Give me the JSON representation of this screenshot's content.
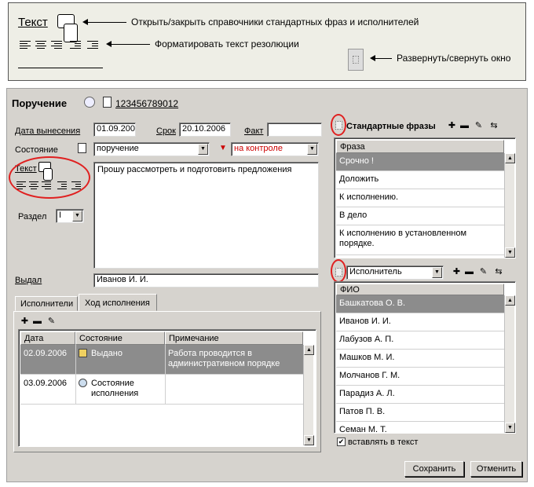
{
  "legend": {
    "text_label": "Текст",
    "toggle_refs": "Открыть/закрыть справочники стандартных фраз и исполнителей",
    "format_text": "Форматировать текст резолюции",
    "expand_window": "Развернуть/свернуть окно"
  },
  "header": {
    "title": "Поручение",
    "doc_number": "123456789012"
  },
  "fields": {
    "issue_date_label": "Дата вынесения",
    "issue_date": "01.09.2006",
    "due_label": "Срок",
    "due_date": "20.10.2006",
    "fact_label": "Факт",
    "fact_value": "",
    "state_label": "Состояние",
    "state_value": "поручение",
    "control_value": "на контроле",
    "text_label": "Текст",
    "resolution_text": "Прошу рассмотреть и подготовить предложения",
    "section_label": "Раздел",
    "section_value": "I",
    "issued_label": "Выдал",
    "issued_value": "Иванов И. И."
  },
  "tabs": {
    "executors": "Исполнители",
    "progress": "Ход исполнения"
  },
  "progress_table": {
    "columns": [
      "Дата",
      "Состояние",
      "Примечание"
    ],
    "rows": [
      {
        "date": "02.09.2006",
        "state": "Выдано",
        "note": "Работа проводится в административном порядке"
      },
      {
        "date": "03.09.2006",
        "state": "Состояние исполнения",
        "note": ""
      }
    ]
  },
  "phrases": {
    "title": "Стандартные фразы",
    "column": "Фраза",
    "items": [
      "Срочно !",
      "Доложить",
      "К исполнению.",
      "В дело",
      "К исполнению в установленном порядке."
    ]
  },
  "executors": {
    "selector_value": "Исполнитель",
    "column": "ФИО",
    "items": [
      "Башкатова О. В.",
      "Иванов И. И.",
      "Лабузов А. П.",
      "Машков М. И.",
      "Молчанов Г. М.",
      "Парадиз А. Л.",
      "Патов П. В.",
      "Семан М. Т."
    ],
    "insert_in_text": "вставлять в текст"
  },
  "buttons": {
    "save": "Сохранить",
    "cancel": "Отменить"
  },
  "colors": {
    "form_bg": "#d6d3ce",
    "selected_row": "#8c8c8c",
    "highlight": "#e02020",
    "control_text": "#cc0000"
  }
}
